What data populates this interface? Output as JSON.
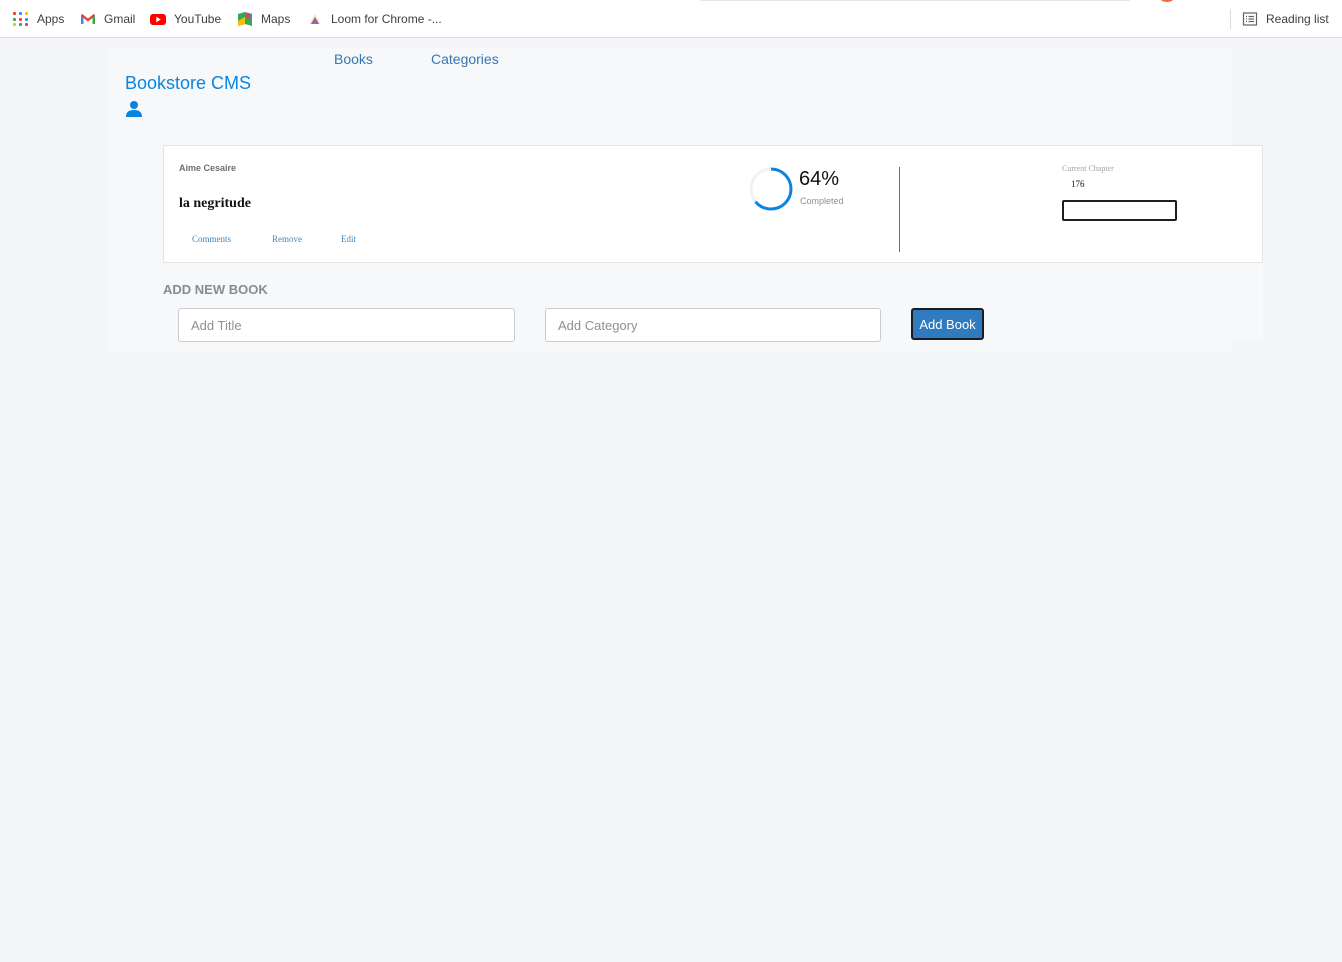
{
  "bookmarks": {
    "apps": "Apps",
    "gmail": "Gmail",
    "youtube": "YouTube",
    "maps": "Maps",
    "loom": "Loom for Chrome -...",
    "reading_list": "Reading list"
  },
  "app": {
    "brand": "Bookstore CMS",
    "nav": {
      "books": "Books",
      "categories": "Categories"
    }
  },
  "book": {
    "author": "Aime Cesaire",
    "title": "la negritude",
    "actions": {
      "comments": "Comments",
      "remove": "Remove",
      "edit": "Edit"
    },
    "progress_percent": 64,
    "progress_text": "64%",
    "completed_label": "Completed",
    "current_chapter_label": "Current Chapter",
    "current_chapter_value": "176"
  },
  "form": {
    "heading": "ADD NEW BOOK",
    "title_placeholder": "Add Title",
    "category_placeholder": "Add Category",
    "submit_label": "Add Book"
  },
  "colors": {
    "brand": "#0b84e0",
    "nav_link": "#3777b4",
    "progress": "#0b84e0",
    "button": "#307bbf"
  }
}
